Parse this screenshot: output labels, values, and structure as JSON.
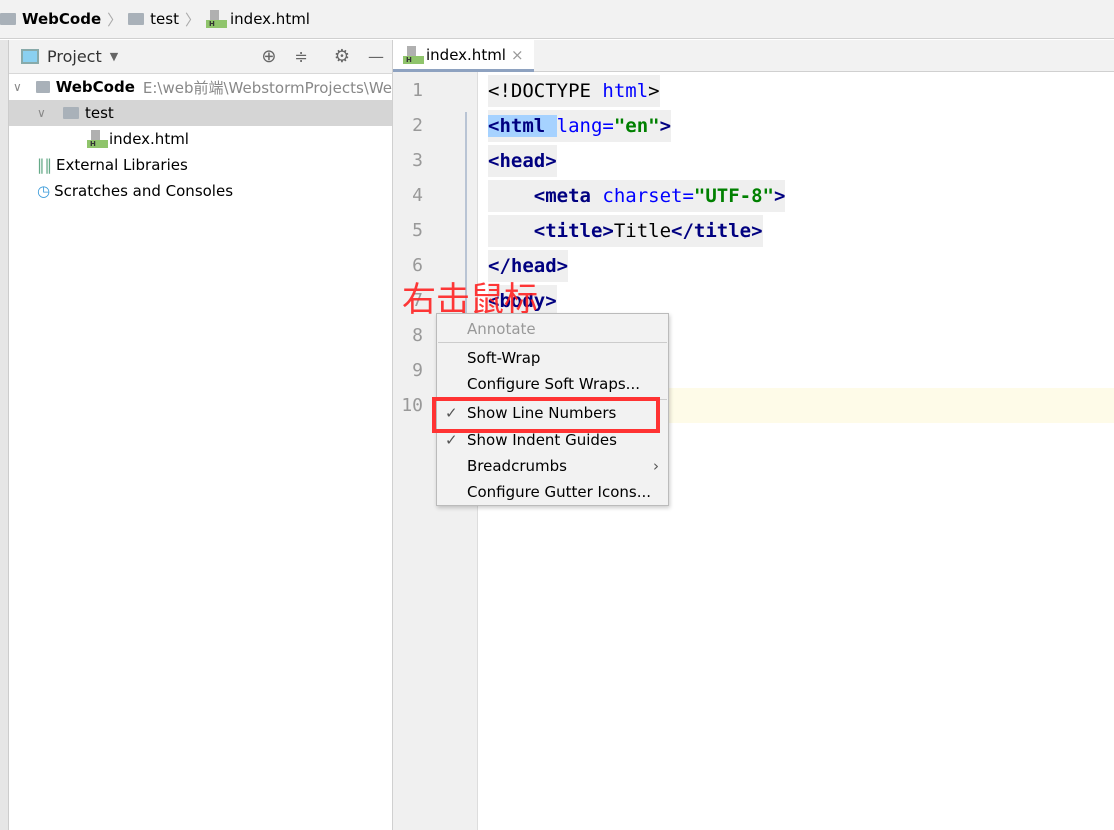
{
  "breadcrumb": [
    "WebCode",
    "test",
    "index.html"
  ],
  "project": {
    "title": "Project",
    "root": {
      "label": "WebCode",
      "path": "E:\\web前端\\WebstormProjects\\We"
    },
    "items": [
      "test",
      "index.html",
      "External Libraries",
      "Scratches and Consoles"
    ]
  },
  "tab": {
    "label": "index.html",
    "close": "×"
  },
  "code": [
    [
      [
        "t",
        "<!DOCTYPE "
      ],
      [
        "a",
        "html"
      ],
      [
        "t",
        ">"
      ]
    ],
    [
      [
        "g",
        "<html "
      ],
      [
        "a",
        "lang="
      ],
      [
        "s",
        "\"en\""
      ],
      [
        "g",
        ">"
      ]
    ],
    [
      [
        "g",
        "<head>"
      ]
    ],
    [
      [
        "t",
        "    "
      ],
      [
        "g",
        "<meta "
      ],
      [
        "a",
        "charset="
      ],
      [
        "s",
        "\"UTF-8\""
      ],
      [
        "g",
        ">"
      ]
    ],
    [
      [
        "t",
        "    "
      ],
      [
        "g",
        "<title>"
      ],
      [
        "t",
        "Title"
      ],
      [
        "g",
        "</title>"
      ]
    ],
    [
      [
        "g",
        "</head>"
      ]
    ],
    [
      [
        "g",
        "<body>"
      ]
    ],
    [],
    [],
    []
  ],
  "annotation": "右击鼠标",
  "menu": {
    "items": [
      {
        "label": "Annotate",
        "disabled": true
      },
      {
        "label": "Soft-Wrap"
      },
      {
        "label": "Configure Soft Wraps..."
      },
      {
        "label": "Show Line Numbers",
        "checked": true
      },
      {
        "label": "Show Indent Guides",
        "checked": true
      },
      {
        "label": "Breadcrumbs",
        "submenu": true
      },
      {
        "label": "Configure Gutter Icons..."
      }
    ]
  },
  "colors": {
    "highlight": "#f33",
    "current_line": "#fefbe8",
    "tag": "#000080",
    "string": "#008000"
  }
}
